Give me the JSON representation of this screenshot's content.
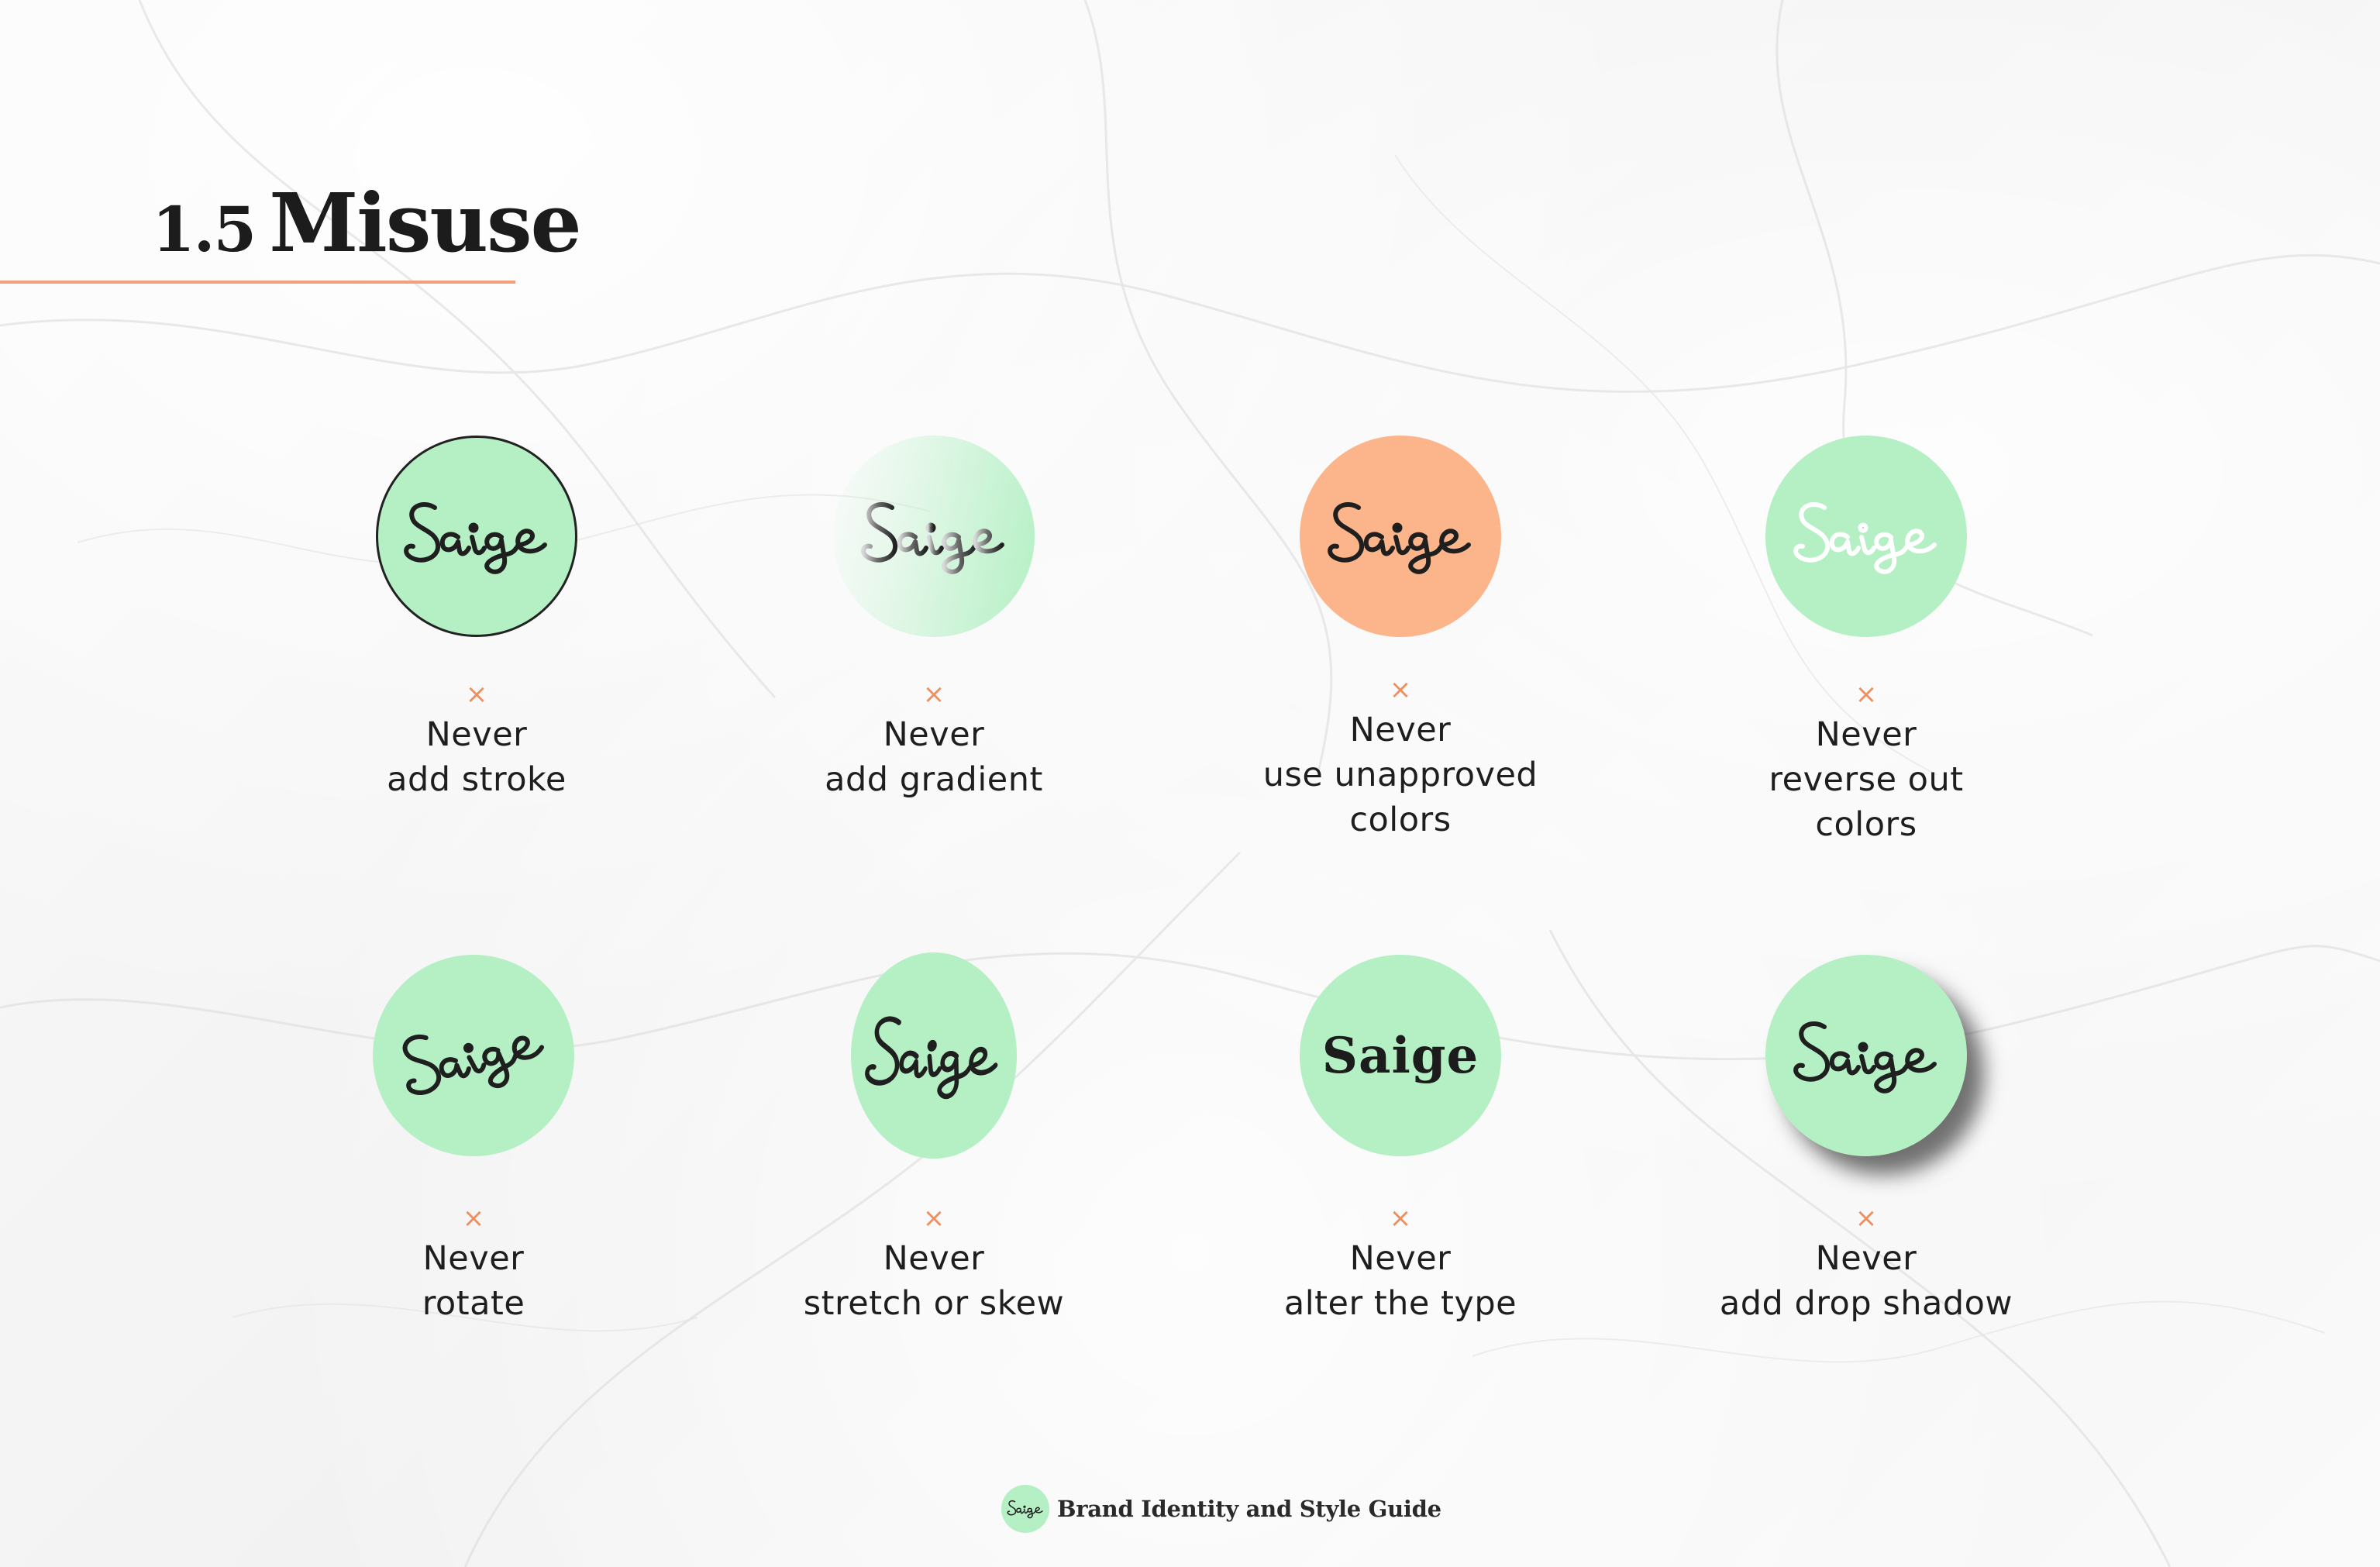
{
  "page": {
    "section_number": "1.5",
    "title": "Misuse",
    "accent_color": "#f2a07b",
    "brand_green": "#b4f0c4",
    "unapproved_orange": "#fcb58b"
  },
  "misuse_items": [
    {
      "icon": "saige-logo-with-stroke-icon",
      "mark": "×",
      "never": "Never",
      "line2": "add stroke",
      "line3": ""
    },
    {
      "icon": "saige-logo-with-gradient-icon",
      "mark": "×",
      "never": "Never",
      "line2": "add gradient",
      "line3": ""
    },
    {
      "icon": "saige-logo-unapproved-color-icon",
      "mark": "×",
      "never": "Never",
      "line2": "use unapproved",
      "line3": "colors"
    },
    {
      "icon": "saige-logo-reversed-icon",
      "mark": "×",
      "never": "Never",
      "line2": "reverse out",
      "line3": "colors"
    },
    {
      "icon": "saige-logo-rotated-icon",
      "mark": "×",
      "never": "Never",
      "line2": "rotate",
      "line3": ""
    },
    {
      "icon": "saige-logo-stretched-icon",
      "mark": "×",
      "never": "Never",
      "line2": "stretch or skew",
      "line3": ""
    },
    {
      "icon": "saige-logo-altered-type-icon",
      "mark": "×",
      "never": "Never",
      "line2": "alter the type",
      "line3": "",
      "altered_wordmark": "Saige"
    },
    {
      "icon": "saige-logo-drop-shadow-icon",
      "mark": "×",
      "never": "Never",
      "line2": "add drop shadow",
      "line3": ""
    }
  ],
  "footer": {
    "logo_word": "Saige",
    "text": "Brand Identity and Style Guide"
  }
}
